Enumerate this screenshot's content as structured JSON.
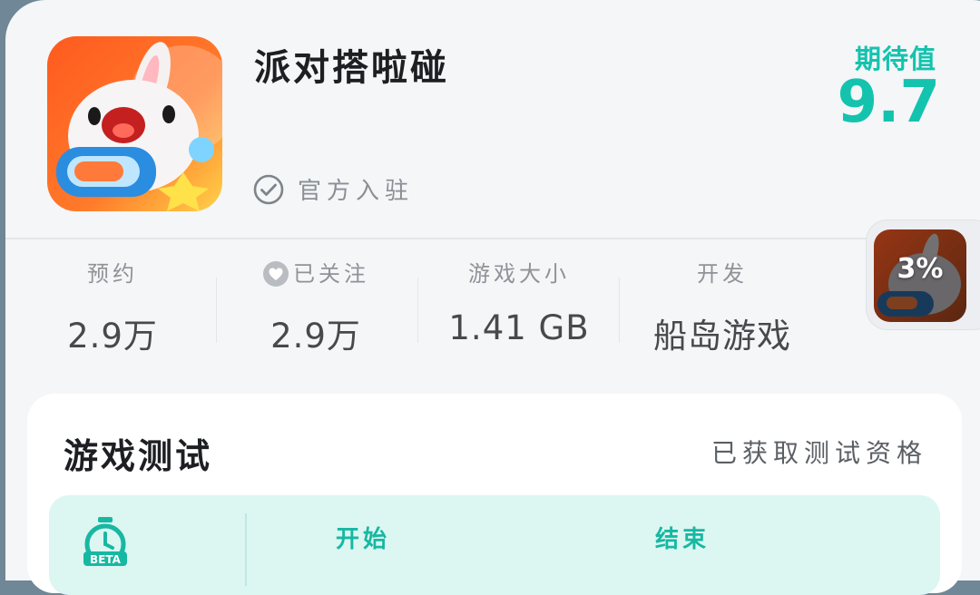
{
  "app": {
    "title": "派对搭啦碰",
    "verified_label": "官方入驻",
    "expect_label": "期待值",
    "expect_score": "9.7"
  },
  "stats": [
    {
      "label": "预约",
      "value": "2.9万"
    },
    {
      "label": "已关注",
      "value": "2.9万"
    },
    {
      "label": "游戏大小",
      "value": "1.41 GB"
    },
    {
      "label": "开发",
      "value": "船岛游戏"
    }
  ],
  "floating": {
    "percent": "3%"
  },
  "test": {
    "title": "游戏测试",
    "status": "已获取测试资格",
    "col_start": "开始",
    "col_end": "结束"
  },
  "colors": {
    "accent": "#14c3ae",
    "accent_soft": "#dcf6f2",
    "text_dark": "#1d1f22",
    "text_muted": "#8f9398"
  },
  "icons": [
    "check-circle-icon",
    "heart-icon",
    "beta-timer-icon"
  ]
}
